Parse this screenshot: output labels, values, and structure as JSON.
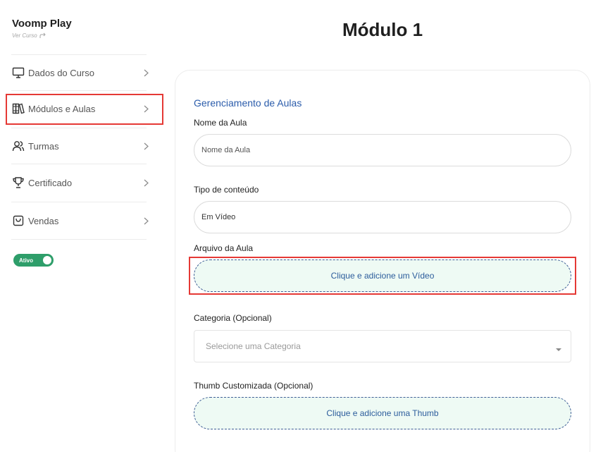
{
  "brand": {
    "title": "Voomp Play",
    "subtitle": "Ver Curso"
  },
  "sidebar": {
    "items": [
      {
        "label": "Dados do Curso",
        "icon": "monitor-icon"
      },
      {
        "label": "Módulos e Aulas",
        "icon": "books-icon",
        "highlighted": true
      },
      {
        "label": "Turmas",
        "icon": "users-icon"
      },
      {
        "label": "Certificado",
        "icon": "trophy-icon"
      },
      {
        "label": "Vendas",
        "icon": "shopping-bag-icon"
      }
    ],
    "status_toggle": {
      "label": "Ativo",
      "on": true
    }
  },
  "main": {
    "title": "Módulo 1",
    "section_title": "Gerenciamento de Aulas",
    "lesson_name": {
      "label": "Nome da Aula",
      "placeholder": "Nome da Aula"
    },
    "content_type": {
      "label": "Tipo de conteúdo",
      "value": "Em Vídeo"
    },
    "lesson_file": {
      "label": "Arquivo da Aula",
      "upload_text": "Clique e adicione um Vídeo",
      "highlighted": true
    },
    "category": {
      "label": "Categoria (Opcional)",
      "placeholder": "Selecione uma Categoria"
    },
    "custom_thumb": {
      "label": "Thumb Customizada (Opcional)",
      "upload_text": "Clique e adicione uma Thumb"
    }
  },
  "colors": {
    "highlight": "#e53935",
    "accent_blue": "#2b5cab",
    "toggle_green": "#2e9e6a",
    "upload_bg": "#eefaf4"
  }
}
